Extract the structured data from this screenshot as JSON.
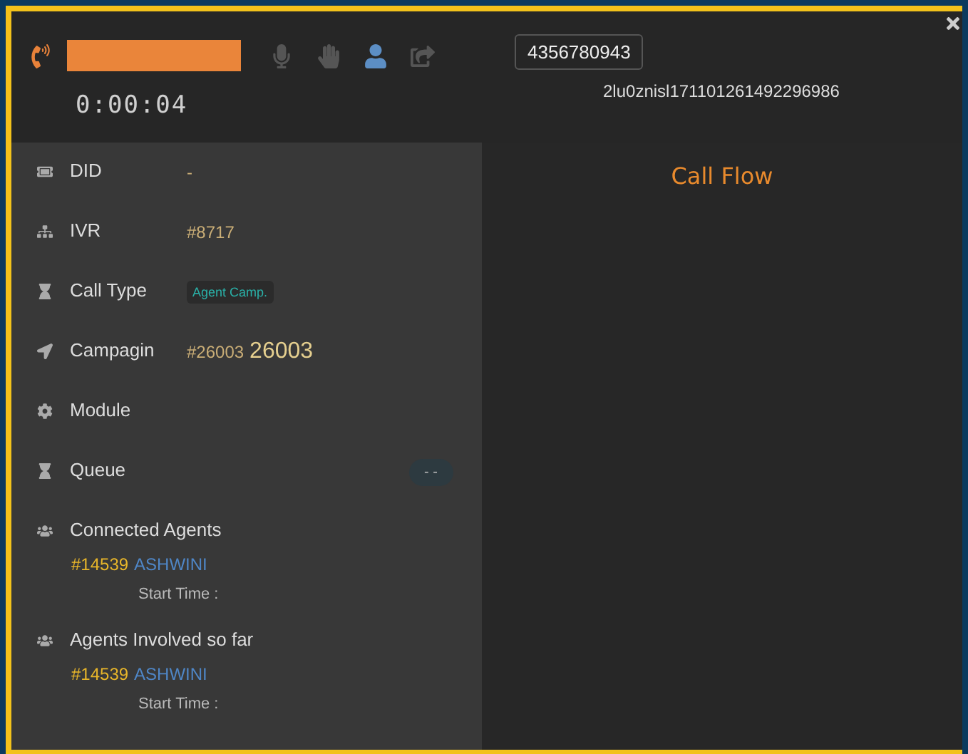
{
  "header": {
    "timer": "0:00:04",
    "phone_number": "4356780943",
    "call_id": "2lu0znisl171101261492296986",
    "toolbar": [
      {
        "kind": "mic",
        "active": false
      },
      {
        "kind": "hand",
        "active": false
      },
      {
        "kind": "user",
        "active": true
      },
      {
        "kind": "share",
        "active": false
      }
    ]
  },
  "details": [
    {
      "kind": "text",
      "label": "DID",
      "value": "-"
    },
    {
      "kind": "text",
      "label": "IVR",
      "value": "#8717"
    },
    {
      "kind": "tag",
      "label": "Call Type",
      "value": "Agent Camp."
    },
    {
      "kind": "campaign",
      "label": "Campagin",
      "value": "#26003",
      "name": "26003"
    },
    {
      "kind": "text",
      "label": "Module"
    },
    {
      "kind": "pill",
      "label": "Queue",
      "value": "- -"
    },
    {
      "kind": "agents",
      "label": "Connected Agents",
      "agents": [
        {
          "id": "#14539",
          "name": "ASHWINI",
          "start_label": "Start Time :"
        }
      ]
    },
    {
      "kind": "agents",
      "label": "Agents Involved so far",
      "agents": [
        {
          "id": "#14539",
          "name": "ASHWINI",
          "start_label": "Start Time :"
        }
      ]
    }
  ],
  "call_flow": {
    "title": "Call Flow"
  }
}
